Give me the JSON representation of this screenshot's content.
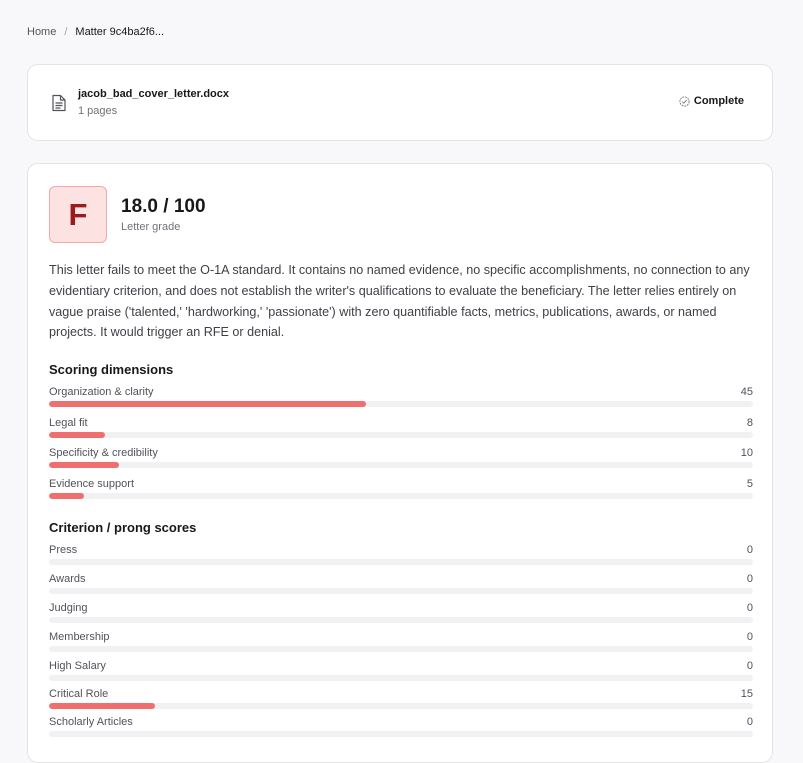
{
  "breadcrumb": {
    "home": "Home",
    "separator": "/",
    "current": "Matter 9c4ba2f6..."
  },
  "file": {
    "icon": "file-text-icon",
    "name": "jacob_bad_cover_letter.docx",
    "pages": "1 pages",
    "status": "Complete",
    "status_icon": "check-circle-icon"
  },
  "grade": {
    "letter": "F",
    "score": "18.0 / 100",
    "label": "Letter grade",
    "summary": "This letter fails to meet the O-1A standard. It contains no named evidence, no specific accomplishments, no connection to any evidentiary criterion, and does not establish the writer's qualifications to evaluate the beneficiary. The letter relies entirely on vague praise ('talented,' 'hardworking,' 'passionate') with zero quantifiable facts, metrics, publications, awards, or named projects. It would trigger an RFE or denial."
  },
  "colors": {
    "bar_fill": "#ef6f6f",
    "track": "#f1f1f3",
    "grade_bg": "#fde2e2",
    "grade_text": "#991b1b"
  },
  "dimensions": {
    "title": "Scoring dimensions",
    "items": [
      {
        "label": "Organization & clarity",
        "value": "45",
        "score": 45
      },
      {
        "label": "Legal fit",
        "value": "8",
        "score": 8
      },
      {
        "label": "Specificity & credibility",
        "value": "10",
        "score": 10
      },
      {
        "label": "Evidence support",
        "value": "5",
        "score": 5
      }
    ]
  },
  "criteria": {
    "title": "Criterion / prong scores",
    "items": [
      {
        "label": "Press",
        "value": "0",
        "score": 0
      },
      {
        "label": "Awards",
        "value": "0",
        "score": 0
      },
      {
        "label": "Judging",
        "value": "0",
        "score": 0
      },
      {
        "label": "Membership",
        "value": "0",
        "score": 0
      },
      {
        "label": "High Salary",
        "value": "0",
        "score": 0
      },
      {
        "label": "Critical Role",
        "value": "15",
        "score": 15
      },
      {
        "label": "Scholarly Articles",
        "value": "0",
        "score": 0
      }
    ]
  }
}
